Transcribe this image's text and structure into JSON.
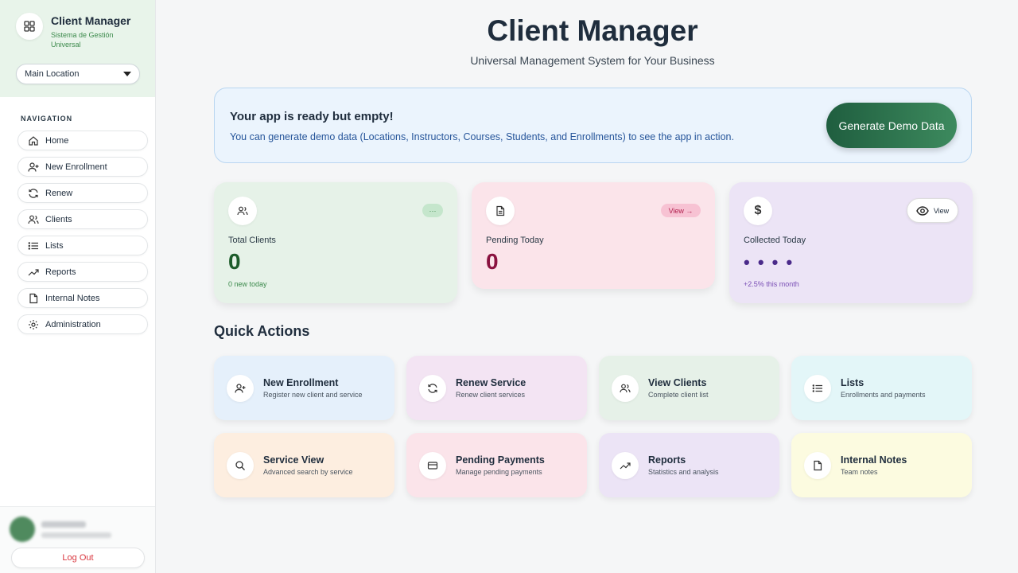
{
  "sidebar": {
    "brand_title": "Client Manager",
    "brand_subtitle": "Sistema de Gestión Universal",
    "location": "Main Location",
    "nav_title": "NAVIGATION",
    "items": [
      {
        "label": "Home",
        "icon": "home-icon"
      },
      {
        "label": "New Enrollment",
        "icon": "user-plus-icon"
      },
      {
        "label": "Renew",
        "icon": "refresh-icon"
      },
      {
        "label": "Clients",
        "icon": "users-icon"
      },
      {
        "label": "Lists",
        "icon": "list-icon"
      },
      {
        "label": "Reports",
        "icon": "trending-up-icon"
      },
      {
        "label": "Internal Notes",
        "icon": "file-icon"
      },
      {
        "label": "Administration",
        "icon": "gear-icon"
      }
    ],
    "logout": "Log Out"
  },
  "header": {
    "title": "Client Manager",
    "subtitle": "Universal Management System for Your Business"
  },
  "banner": {
    "title": "Your app is ready but empty!",
    "text": "You can generate demo data (Locations, Instructors, Courses, Students, and Enrollments) to see the app in action.",
    "button": "Generate Demo Data"
  },
  "stats": {
    "total_clients": {
      "label": "Total Clients",
      "value": "0",
      "foot": "0 new today",
      "pill": "···"
    },
    "pending_today": {
      "label": "Pending Today",
      "value": "0",
      "pill": "View →"
    },
    "collected_today": {
      "label": "Collected Today",
      "value": "• • • •",
      "foot": "+2.5% this month",
      "button": "View"
    }
  },
  "quick_actions": {
    "title": "Quick Actions",
    "items": [
      {
        "title": "New Enrollment",
        "desc": "Register new client and service"
      },
      {
        "title": "Renew Service",
        "desc": "Renew client services"
      },
      {
        "title": "View Clients",
        "desc": "Complete client list"
      },
      {
        "title": "Lists",
        "desc": "Enrollments and payments"
      },
      {
        "title": "Service View",
        "desc": "Advanced search by service"
      },
      {
        "title": "Pending Payments",
        "desc": "Manage pending payments"
      },
      {
        "title": "Reports",
        "desc": "Statistics and analysis"
      },
      {
        "title": "Internal Notes",
        "desc": "Team notes"
      }
    ]
  },
  "colors": {
    "accent_green": "#1f5e3f",
    "pending_value": "#8a1240",
    "clients_value": "#1c5c2a",
    "collected_value": "#4a2a8a"
  }
}
